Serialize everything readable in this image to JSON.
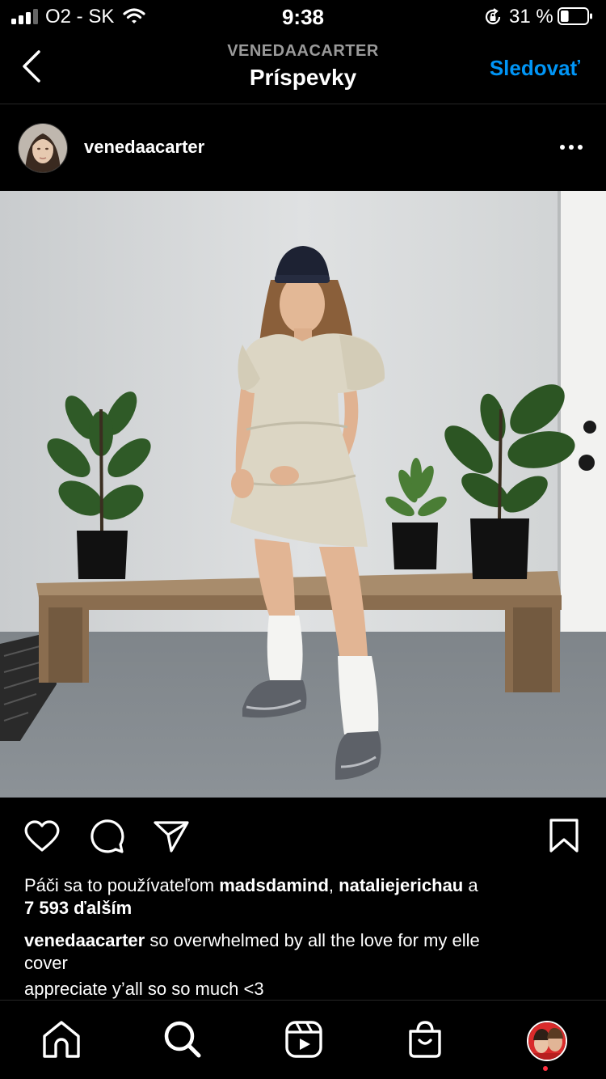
{
  "status_bar": {
    "carrier": "O2 - SK",
    "time": "9:38",
    "battery_percent": "31 %",
    "battery_level": 0.31,
    "icons": [
      "signal-icon",
      "wifi-icon",
      "orientation-lock-icon",
      "battery-icon"
    ]
  },
  "nav": {
    "username": "VENEDAACARTER",
    "title": "Príspevky",
    "follow_label": "Sledovať",
    "back_icon": "chevron-left-icon"
  },
  "post": {
    "username": "venedaacarter",
    "more_icon": "more-horizontal-icon",
    "actions": [
      "heart-icon",
      "comment-icon",
      "share-icon",
      "bookmark-icon"
    ],
    "likes": {
      "prefix": "Páči sa to používateľom",
      "user1": "madsdamind",
      "separator": ",",
      "user2": "nataliejerichau",
      "conjunction": "a",
      "count": "7 593 ďalším"
    },
    "caption": {
      "username": "venedaacarter",
      "text_line1": "so overwhelmed by all the love for my elle",
      "text_line2": "cover",
      "text_line3": "appreciate y’all so so much <3"
    }
  },
  "tab_bar": {
    "items": [
      "home-icon",
      "search-icon",
      "reels-icon",
      "shop-icon",
      "profile-avatar"
    ],
    "accent": "#ff3040"
  },
  "colors": {
    "accent": "#0095f6",
    "background": "#000000",
    "secondary_text": "#9a9a9a"
  }
}
